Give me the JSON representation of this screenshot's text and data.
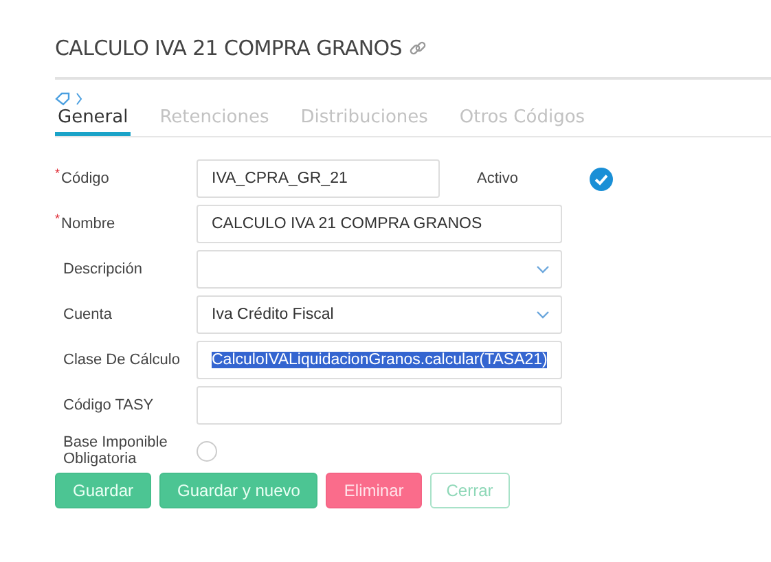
{
  "title": "CALCULO IVA 21 COMPRA GRANOS",
  "tabs": [
    {
      "label": "General",
      "selected": true
    },
    {
      "label": "Retenciones",
      "selected": false
    },
    {
      "label": "Distribuciones",
      "selected": false
    },
    {
      "label": "Otros Códigos",
      "selected": false
    }
  ],
  "fields": [
    {
      "kind": "text",
      "label": "Código",
      "required_mark": "*",
      "value": "IVA_CPRA_GR_21",
      "extra": {
        "label": "Activo",
        "checked": true
      }
    },
    {
      "kind": "text",
      "label": "Nombre",
      "required_mark": "*",
      "value": "CALCULO IVA 21 COMPRA GRANOS"
    },
    {
      "kind": "select",
      "label": "Descripción"
    },
    {
      "kind": "select",
      "label": "Cuenta",
      "value": "Iva Crédito Fiscal"
    },
    {
      "kind": "text",
      "label": "Clase De Cálculo",
      "value": "CalculoIVALiquidacionGranos.calcular(TASA21)",
      "highlighted": true
    },
    {
      "kind": "text",
      "label": "Código TASY"
    },
    {
      "kind": "toggle",
      "label": "Base Imponible Obligatoria",
      "checked": false
    }
  ],
  "buttons": [
    {
      "label": "Guardar",
      "kind": "primary"
    },
    {
      "label": "Guardar y nuevo",
      "kind": "primary"
    },
    {
      "label": "Eliminar",
      "kind": "danger"
    },
    {
      "label": "Cerrar",
      "kind": "outline"
    }
  ]
}
